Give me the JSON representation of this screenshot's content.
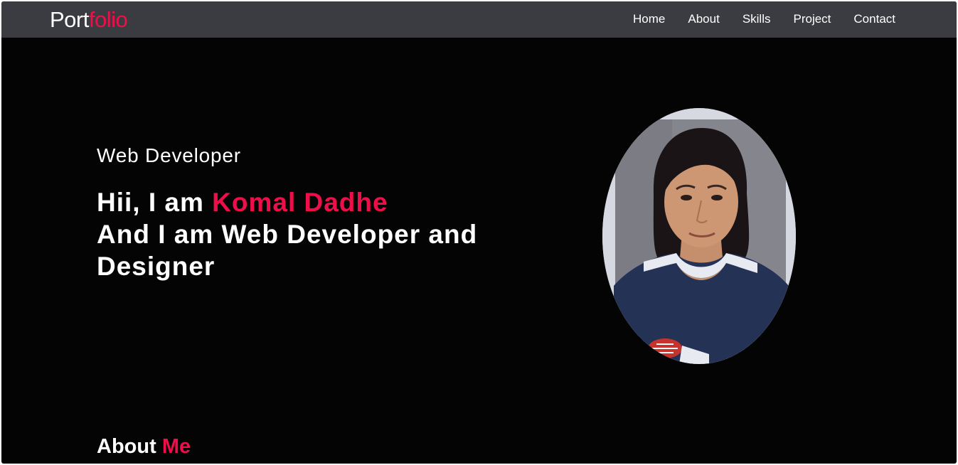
{
  "navbar": {
    "logo_main": "Port",
    "logo_accent": "folio",
    "links": [
      {
        "label": "Home"
      },
      {
        "label": "About"
      },
      {
        "label": "Skills"
      },
      {
        "label": "Project"
      },
      {
        "label": "Contact"
      }
    ]
  },
  "hero": {
    "subtitle": "Web Developer",
    "greeting": "Hii, I am ",
    "name": "Komal Dadhe",
    "tagline": "And I am Web Developer and Designer"
  },
  "about": {
    "heading_main": "About ",
    "heading_accent": "Me"
  },
  "colors": {
    "accent": "#ee0f4a",
    "background": "#050405",
    "navbar": "#3b3c41",
    "text": "#ffffff"
  }
}
